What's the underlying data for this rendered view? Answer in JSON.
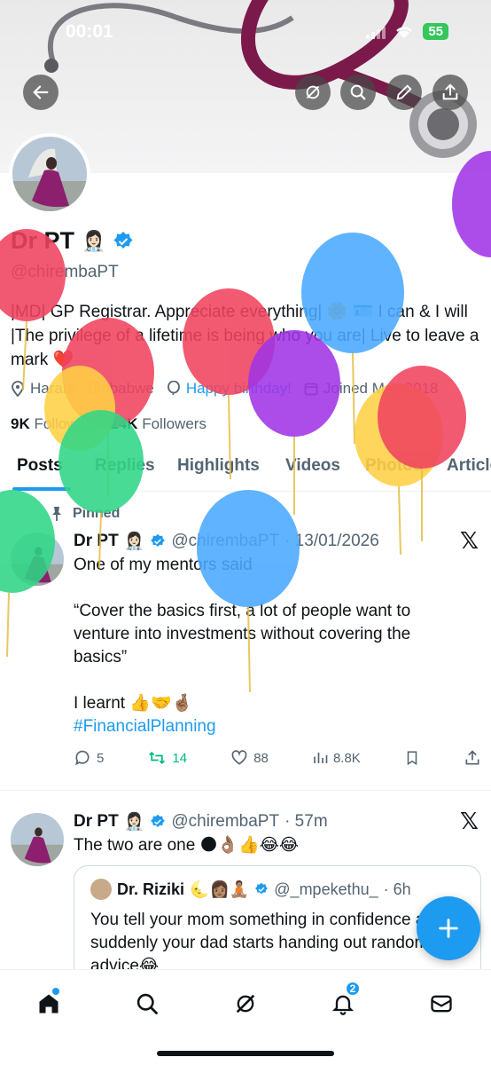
{
  "status_bar": {
    "time": "00:01",
    "battery": "55"
  },
  "profile": {
    "name": "Dr PT",
    "name_emoji": "👩🏻‍⚕️",
    "handle": "@chirembaPT",
    "bio": "|MD| GP Registrar. Appreciate everything| 🌼 🪪 I can & I will |The privilege of a lifetime is being who you are| Live to leave a mark ❤️",
    "location": "Harare, Zimbabwe",
    "birthday": "Happy birthday!",
    "joined": "Joined May 2018",
    "following_count": "9K",
    "following_label": "Following",
    "followers_count": "14K",
    "followers_label": "Followers"
  },
  "tabs": [
    "Posts",
    "Replies",
    "Highlights",
    "Videos",
    "Photos",
    "Articles"
  ],
  "tweets": [
    {
      "pinned_label": "Pinned",
      "name": "Dr PT",
      "emoji": "👩🏻‍⚕️",
      "handle": "@chirembaPT",
      "time": "· 13/01/2026",
      "line1": "One of my mentors said",
      "line2": "“Cover the basics first, a lot of people want to venture into investments without covering the basics”",
      "line3": "I learnt 👍🤝🤞🏽",
      "hashtag": "#FinancialPlanning",
      "replies": "5",
      "reposts": "14",
      "likes": "88",
      "views": "8.8K"
    },
    {
      "name": "Dr PT",
      "emoji": "👩🏻‍⚕️",
      "handle": "@chirembaPT",
      "time": "· 57m",
      "text": "The two are one 🌑👌🏽👍😂😂",
      "quote": {
        "name": "Dr. Riziki",
        "emoji": "🌜👩🏽🧘🏽",
        "handle": "@_mpekethu_",
        "time": "· 6h",
        "text": "You tell your mom something in confidence and suddenly your dad starts handing out random life advice😂"
      }
    }
  ],
  "colors": {
    "accent": "#1d9bf0",
    "repost": "#00ba7c",
    "text": "#0f1419",
    "muted": "#536471"
  },
  "icons": [
    "back-icon",
    "grok-icon",
    "search-icon",
    "edit-icon",
    "share-icon",
    "home-icon",
    "explore-icon",
    "grok-nav-icon",
    "bell-icon",
    "mail-icon",
    "plus-icon"
  ],
  "nav": {
    "notifications_badge": "2"
  }
}
